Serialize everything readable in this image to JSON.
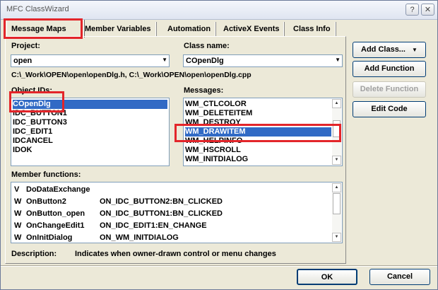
{
  "window": {
    "title": "MFC ClassWizard",
    "help_glyph": "?",
    "close_glyph": "✕"
  },
  "tabs": [
    "Message Maps",
    "Member Variables",
    "Automation",
    "ActiveX Events",
    "Class Info"
  ],
  "project": {
    "label": "Project:",
    "value": "open"
  },
  "class_name": {
    "label": "Class name:",
    "value": "COpenDlg"
  },
  "files_path": "C:\\_Work\\OPEN\\open\\openDlg.h, C:\\_Work\\OPEN\\open\\openDlg.cpp",
  "object_ids": {
    "label": "Object IDs:",
    "items": [
      "COpenDlg",
      "IDC_BUTTON1",
      "IDC_BUTTON3",
      "IDC_EDIT1",
      "IDCANCEL",
      "IDOK"
    ],
    "selected": "COpenDlg"
  },
  "messages": {
    "label": "Messages:",
    "items": [
      "WM_CTLCOLOR",
      "WM_DELETEITEM",
      "WM_DESTROY",
      "WM_DRAWITEM",
      "WM_HELPINFO",
      "WM_HSCROLL",
      "WM_INITDIALOG"
    ],
    "selected": "WM_DRAWITEM"
  },
  "member_functions": {
    "label": "Member functions:",
    "rows": [
      {
        "icon": "V",
        "name": "DoDataExchange",
        "handler": ""
      },
      {
        "icon": "W",
        "name": "OnButton2",
        "handler": "ON_IDC_BUTTON2:BN_CLICKED"
      },
      {
        "icon": "W",
        "name": "OnButton_open",
        "handler": "ON_IDC_BUTTON1:BN_CLICKED"
      },
      {
        "icon": "W",
        "name": "OnChangeEdit1",
        "handler": "ON_IDC_EDIT1:EN_CHANGE"
      },
      {
        "icon": "W",
        "name": "OnInitDialog",
        "handler": "ON_WM_INITDIALOG"
      }
    ]
  },
  "description": {
    "label": "Description:",
    "text": "Indicates when owner-drawn control or menu changes"
  },
  "buttons": {
    "add_class": "Add Class...",
    "add_function": "Add Function",
    "delete_function": "Delete Function",
    "edit_code": "Edit Code",
    "ok": "OK",
    "cancel": "Cancel"
  },
  "colors": {
    "highlight": "#316ac5",
    "annotation_red": "#e3252a"
  }
}
